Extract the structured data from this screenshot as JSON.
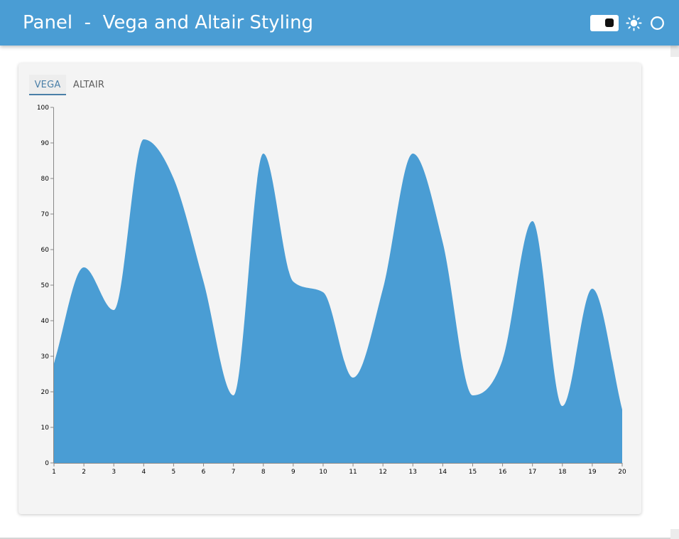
{
  "header": {
    "title": "Panel  -  Vega and Altair Styling",
    "background": "#4a9dd4"
  },
  "controls": {
    "toggle_icon": "theme-toggle-icon",
    "sun_icon": "sun-icon",
    "circle_icon": "circle-icon"
  },
  "tabs": [
    {
      "label": "VEGA",
      "active": true
    },
    {
      "label": "ALTAIR",
      "active": false
    }
  ],
  "chart_data": {
    "type": "area",
    "interpolate": "monotone",
    "x": [
      1,
      2,
      3,
      4,
      5,
      6,
      7,
      8,
      9,
      10,
      11,
      12,
      13,
      14,
      15,
      16,
      17,
      18,
      19,
      20
    ],
    "values": [
      28,
      55,
      43,
      91,
      80,
      51,
      19,
      87,
      51,
      48,
      24,
      49,
      87,
      62,
      19,
      29,
      68,
      16,
      49,
      15
    ],
    "x_ticks": [
      "1",
      "2",
      "3",
      "4",
      "5",
      "6",
      "7",
      "8",
      "9",
      "10",
      "11",
      "12",
      "13",
      "14",
      "15",
      "16",
      "17",
      "18",
      "19",
      "20"
    ],
    "y_ticks": [
      "0",
      "10",
      "20",
      "30",
      "40",
      "50",
      "60",
      "70",
      "80",
      "90",
      "100"
    ],
    "xlim": [
      1,
      20
    ],
    "ylim": [
      0,
      100
    ],
    "color": "#4a9dd4",
    "xlabel": "",
    "ylabel": "",
    "grid": false
  }
}
